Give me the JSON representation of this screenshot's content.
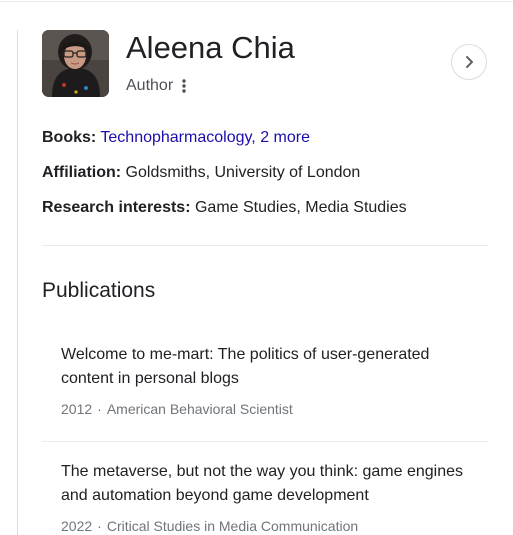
{
  "entity": {
    "name": "Aleena Chia",
    "type": "Author"
  },
  "facts": {
    "books_label": "Books:",
    "books_link": "Technopharmacology",
    "books_more": "2 more",
    "affiliation_label": "Affiliation:",
    "affiliation_value": "Goldsmiths, University of London",
    "research_label": "Research interests:",
    "research_value": "Game Studies, Media Studies"
  },
  "publications": {
    "heading": "Publications",
    "items": [
      {
        "title": "Welcome to me-mart: The politics of user-generated content in personal blogs",
        "year": "2012",
        "source": "American Behavioral Scientist"
      },
      {
        "title": "The metaverse, but not the way you think: game engines and automation beyond game development",
        "year": "2022",
        "source": "Critical Studies in Media Communication"
      }
    ]
  },
  "icons": {
    "more": "more-vert-icon",
    "next": "chevron-right-icon"
  },
  "colors": {
    "link": "#1a0dab",
    "text": "#202124",
    "muted": "#70757a",
    "divider": "#e8eaed"
  }
}
